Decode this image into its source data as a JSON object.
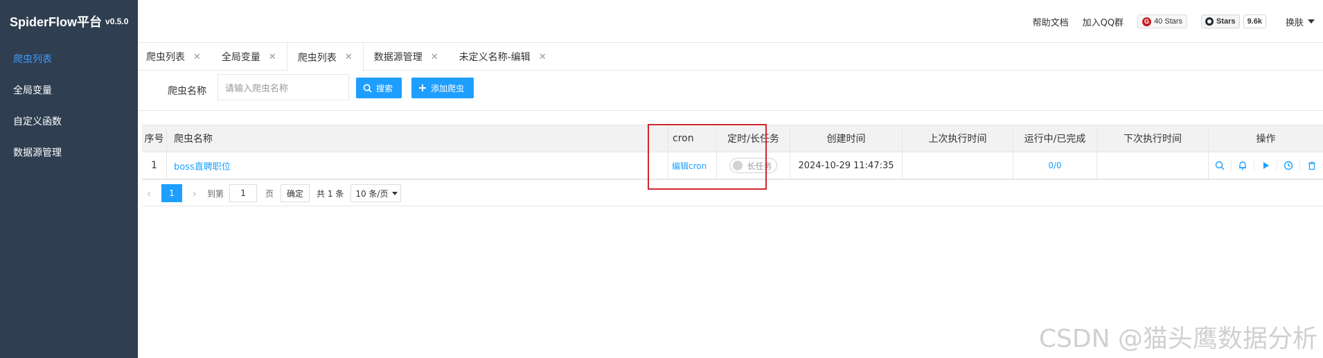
{
  "app": {
    "title": "SpiderFlow平台",
    "version": "v0.5.0"
  },
  "sidebar": {
    "items": [
      {
        "label": "爬虫列表",
        "active": true
      },
      {
        "label": "全局变量",
        "active": false
      },
      {
        "label": "自定义函数",
        "active": false
      },
      {
        "label": "数据源管理",
        "active": false
      }
    ]
  },
  "header": {
    "help": "帮助文档",
    "qq": "加入QQ群",
    "gitee_stars": "40 Stars",
    "github_label": "Stars",
    "github_count": "9.6k",
    "skin": "换肤"
  },
  "tabs": [
    {
      "label": "爬虫列表",
      "active": false
    },
    {
      "label": "全局变量",
      "active": false
    },
    {
      "label": "爬虫列表",
      "active": true
    },
    {
      "label": "数据源管理",
      "active": false
    },
    {
      "label": "未定义名称-编辑",
      "active": false
    }
  ],
  "search": {
    "label": "爬虫名称",
    "placeholder": "请输入爬虫名称",
    "search_btn": "搜索",
    "add_btn": "添加爬虫"
  },
  "table": {
    "headers": [
      "序号",
      "爬虫名称",
      "cron",
      "定时/长任务",
      "创建时间",
      "上次执行时间",
      "运行中/已完成",
      "下次执行时间",
      "操作"
    ],
    "rows": [
      {
        "index": "1",
        "name": "boss直聘职位",
        "cron": "编辑cron",
        "toggle": "长任务",
        "created": "2024-10-29 11:47:35",
        "last_run": "",
        "running": "0/0",
        "next_run": ""
      }
    ],
    "op_icons": [
      "search-icon",
      "bell-icon",
      "play-icon",
      "clock-icon",
      "trash-icon"
    ]
  },
  "pager": {
    "current": "1",
    "goto_label": "到第",
    "goto_value": "1",
    "page_unit": "页",
    "confirm": "确定",
    "total": "共 1 条",
    "page_size": "10 条/页"
  },
  "watermark": "CSDN @猫头鹰数据分析",
  "colors": {
    "sidebar_bg": "#2f3e50",
    "accent": "#1e9fff",
    "highlight": "#d0262d"
  }
}
